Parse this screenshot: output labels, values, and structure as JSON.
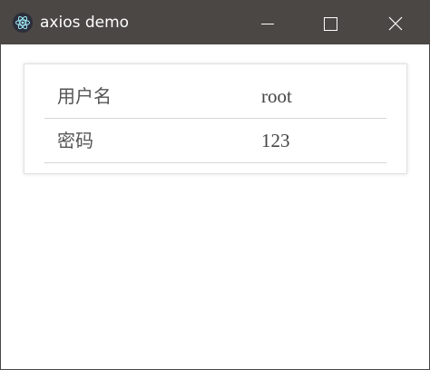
{
  "window": {
    "title": "axios demo",
    "icon": "electron-app-icon",
    "controls": {
      "minimize_icon": "minimize-icon",
      "maximize_icon": "maximize-icon",
      "close_icon": "close-icon"
    },
    "colors": {
      "titlebar": "#4a4744",
      "title_text": "#ffffff"
    }
  },
  "table": {
    "rows": [
      {
        "label": "用户名",
        "value": "root"
      },
      {
        "label": "密码",
        "value": "123"
      }
    ]
  }
}
